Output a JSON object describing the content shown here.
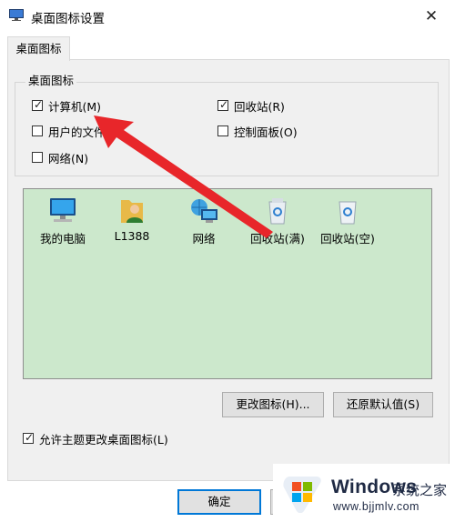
{
  "window": {
    "title": "桌面图标设置",
    "close_glyph": "✕"
  },
  "tabs": [
    {
      "label": "桌面图标"
    }
  ],
  "group": {
    "title": "桌面图标",
    "checkboxes": [
      {
        "label": "计算机(M)",
        "checked": true
      },
      {
        "label": "回收站(R)",
        "checked": true
      },
      {
        "label": "用户的文件",
        "checked": false
      },
      {
        "label": "控制面板(O)",
        "checked": false
      },
      {
        "label": "网络(N)",
        "checked": false
      }
    ]
  },
  "icons": [
    {
      "label": "我的电脑",
      "icon": "computer-icon"
    },
    {
      "label": "L1388",
      "icon": "user-folder-icon"
    },
    {
      "label": "网络",
      "icon": "network-icon"
    },
    {
      "label": "回收站(满)",
      "icon": "recycle-bin-full-icon"
    },
    {
      "label": "回收站(空)",
      "icon": "recycle-bin-empty-icon"
    }
  ],
  "buttons": {
    "change_icon": "更改图标(H)...",
    "restore_default": "还原默认值(S)",
    "ok": "确定"
  },
  "allow_themes": {
    "label": "允许主题更改桌面图标(L)",
    "checked": true
  },
  "watermark": {
    "brand": "Windows",
    "brand_cn": "系统之家",
    "url": "www.bjjmlv.com"
  },
  "colors": {
    "list_bg": "#cce8cc",
    "accent": "#0078d7",
    "arrow": "#e8262a"
  }
}
